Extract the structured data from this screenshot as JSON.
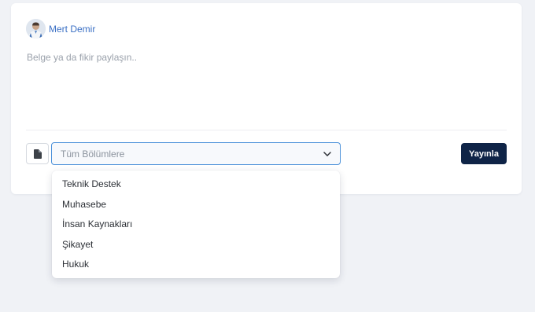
{
  "author": {
    "name": "Mert Demir",
    "avatar_icon": "user-avatar"
  },
  "composer": {
    "placeholder": "Belge ya da fikir paylaşın.."
  },
  "toolbar": {
    "attach_icon": "document-icon",
    "department_select": {
      "selected": "Tüm Bölümlere",
      "chevron_icon": "chevron-down-icon"
    },
    "publish_label": "Yayınla"
  },
  "dropdown": {
    "options": [
      "Teknik Destek",
      "Muhasebe",
      "İnsan Kaynakları",
      "Şikayet",
      "Hukuk"
    ]
  },
  "colors": {
    "accent": "#4a90d9",
    "primary_button": "#0f2447",
    "author_link": "#3a6fc4",
    "background": "#f0f2f6"
  }
}
